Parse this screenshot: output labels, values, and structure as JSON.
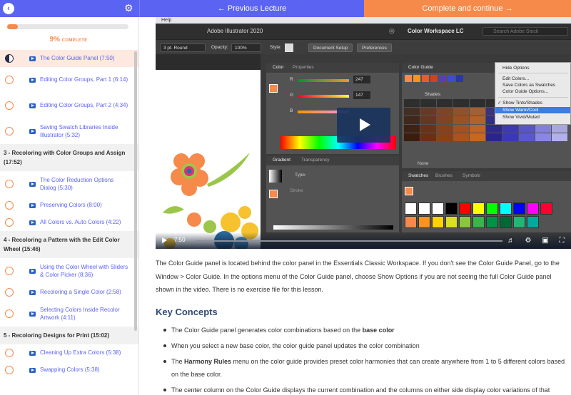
{
  "topbar": {
    "back_icon": "chevron-left-icon",
    "gear_icon": "gear-icon",
    "prev_label": "← Previous Lecture",
    "next_label": "Complete and continue →"
  },
  "progress": {
    "percent": 9,
    "percent_label": "9%",
    "complete_label": "COMPLETE"
  },
  "sidebar": {
    "items": [
      {
        "type": "lesson",
        "title": "The Color Guide Panel (7:50)",
        "status": "in-progress",
        "active": true
      },
      {
        "type": "lesson",
        "title": "Editing Color Groups, Part 1 (6:14)"
      },
      {
        "type": "lesson",
        "title": "Editing Color Groups, Part 2 (4:34)"
      },
      {
        "type": "lesson",
        "title": "Saving Swatch Libraries Inside Illustrator (5:32)"
      },
      {
        "type": "section",
        "title": "3 - Recoloring with Color Groups and Assign (17:52)"
      },
      {
        "type": "lesson",
        "title": "The Color Reduction Options Dialog (5:30)"
      },
      {
        "type": "lesson",
        "title": "Preserving Colors (8:00)"
      },
      {
        "type": "lesson",
        "title": "All Colors vs. Auto Colors (4:22)"
      },
      {
        "type": "section",
        "title": "4 - Recoloring a Pattern with the Edit Color Wheel (15:46)"
      },
      {
        "type": "lesson",
        "title": "Using the Color Wheel with Sliders & Color Picker (8:36)"
      },
      {
        "type": "lesson",
        "title": "Recoloring a Single Color (2:58)"
      },
      {
        "type": "lesson",
        "title": "Selecting Colors Inside Recolor Artwork (4:11)"
      },
      {
        "type": "section",
        "title": "5 - Recoloring Designs for Print (15:02)"
      },
      {
        "type": "lesson",
        "title": "Cleaning Up Extra Colors (5:38)"
      },
      {
        "type": "lesson",
        "title": "Swapping Colors (5:38)"
      }
    ]
  },
  "video": {
    "time": "7:50",
    "app": {
      "menu_help": "Help",
      "title": "Adobe Illustrator 2020",
      "workspace": "Color Workspace LC",
      "search_placeholder": "Search Adobe Stock",
      "stroke_label": "3 pt. Round",
      "opacity_label": "Opacity:",
      "opacity_value": "100%",
      "style_label": "Style:",
      "doc_setup": "Document Setup",
      "preferences": "Preferences",
      "color_tab": "Color",
      "properties_tab": "Properties",
      "color_guide_tab": "Color Guide",
      "r_label": "R",
      "r_value": "247",
      "g_label": "G",
      "g_value": "147",
      "b_label": "B",
      "shades_label": "Shades",
      "gradient_tab": "Gradient",
      "transparency_tab": "Transparency",
      "type_label": "Type:",
      "stroke_text": "Stroke",
      "none_label": "None",
      "swatches_tab": "Swatches",
      "brushes_tab": "Brushes",
      "symbols_tab": "Symbols",
      "menu_items": [
        "Hide Options",
        "Edit Colors...",
        "Save Colors as Swatches",
        "Color Guide Options...",
        "✓ Show Tints/Shades",
        "Show Warm/Cool",
        "Show Vivid/Muted"
      ]
    },
    "colors": {
      "accent": "#f58a4b",
      "primary": "#5b63f2"
    }
  },
  "article": {
    "intro": "The Color Guide panel is located behind the color panel in the Essentials Classic Workspace. If you don't see the Color Guide Panel, go to the Window > Color Guide. In the options menu of the Color Guide panel, choose Show Options if you are not seeing the full Color Guide panel shown in the video. There is no exercise file for this lesson.",
    "heading": "Key Concepts",
    "b1_pre": "The Color Guide panel generates color combinations based on the ",
    "b1_bold": "base color",
    "b2": "When you select a new base color, the color guide panel updates the color combination",
    "b3_pre": "The ",
    "b3_bold": "Harmony Rules",
    "b3_post": " menu on the color guide provides preset color harmonies that can create anywhere from 1 to 5 different colors based on the base color.",
    "b4": "The center column on the Color Guide displays the current combination and the columns on either side display color variations of that"
  }
}
